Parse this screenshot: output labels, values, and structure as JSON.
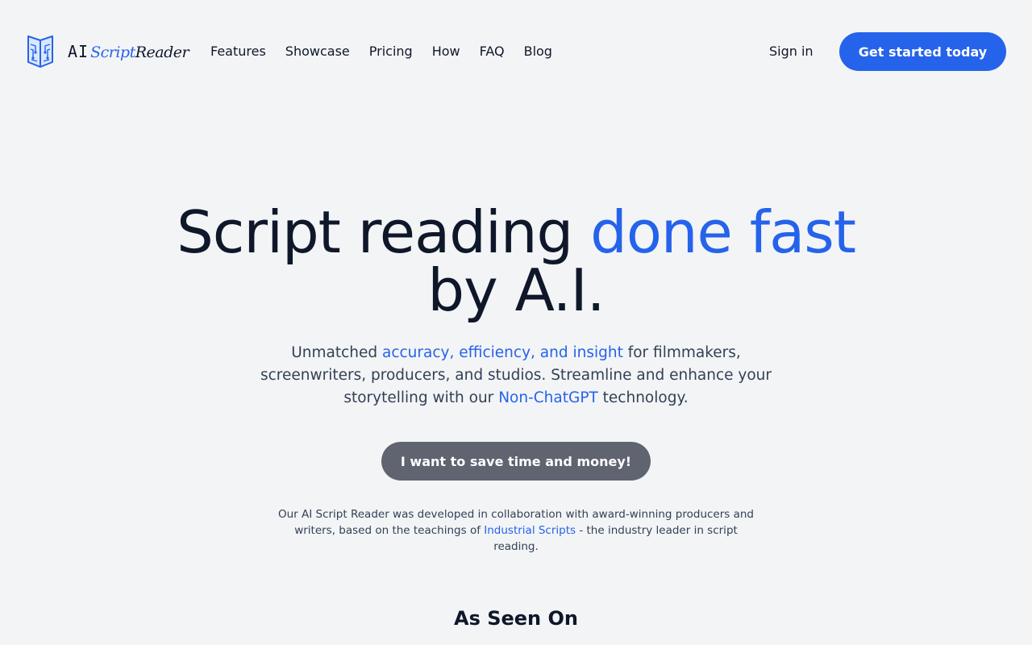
{
  "brand": {
    "logo_ai": "AI",
    "logo_script": "Script",
    "logo_reader": "Reader",
    "icon": "book-circuit-icon",
    "accent_color": "#2563eb"
  },
  "nav": {
    "items": [
      {
        "label": "Features"
      },
      {
        "label": "Showcase"
      },
      {
        "label": "Pricing"
      },
      {
        "label": "How"
      },
      {
        "label": "FAQ"
      },
      {
        "label": "Blog"
      }
    ],
    "sign_in": "Sign in",
    "cta": "Get started today"
  },
  "hero": {
    "title_part1": "Script reading ",
    "title_accent": "done fast",
    "title_part2": "by A.I.",
    "sub_part1": "Unmatched ",
    "sub_highlight1": "accuracy, efficiency, and insight",
    "sub_part2": " for filmmakers, screenwriters, producers, and studios. Streamline and enhance your storytelling with our ",
    "sub_highlight2": "Non-ChatGPT",
    "sub_part3": " technology.",
    "cta": "I want to save time and money!",
    "cta_color": "#5f6470",
    "credit_part1": "Our AI Script Reader was developed in collaboration with award-winning producers and writers, based on the teachings of ",
    "credit_link": "Industrial Scripts",
    "credit_part2": " - the industry leader in script reading."
  },
  "seen_on": {
    "heading": "As Seen On"
  }
}
